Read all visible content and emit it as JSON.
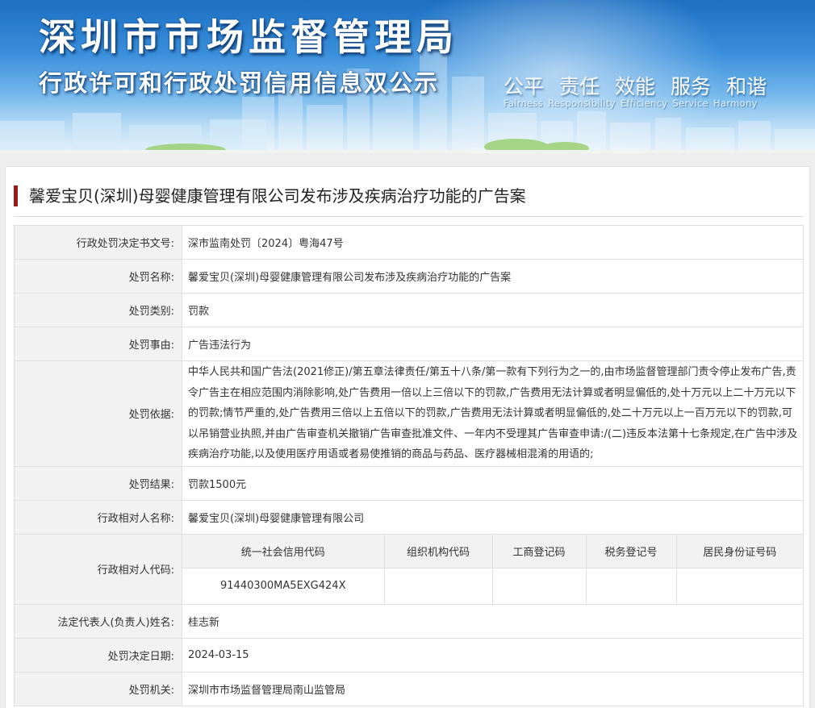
{
  "banner": {
    "title": "深圳市市场监督管理局",
    "subtitle": "行政许可和行政处罚信用信息双公示",
    "slogans": [
      {
        "cn": "公平",
        "en": "Fairness"
      },
      {
        "cn": "责任",
        "en": "Responsibility"
      },
      {
        "cn": "效能",
        "en": "Efficiency"
      },
      {
        "cn": "服务",
        "en": "Service"
      },
      {
        "cn": "和谐",
        "en": "Harmony"
      }
    ]
  },
  "case": {
    "title": "馨爱宝贝(深圳)母婴健康管理有限公司发布涉及疾病治疗功能的广告案"
  },
  "fields": {
    "decision_no": {
      "label": "行政处罚决定书文号:",
      "value": "深市监南处罚〔2024〕粤海47号"
    },
    "penalty_name": {
      "label": "处罚名称:",
      "value": "馨爱宝贝(深圳)母婴健康管理有限公司发布涉及疾病治疗功能的广告案"
    },
    "penalty_type": {
      "label": "处罚类别:",
      "value": "罚款"
    },
    "penalty_reason": {
      "label": "处罚事由:",
      "value": "广告违法行为"
    },
    "penalty_basis": {
      "label": "处罚依据:",
      "value": "中华人民共和国广告法(2021修正)/第五章法律责任/第五十八条/第一款有下列行为之一的,由市场监督管理部门责令停止发布广告,责令广告主在相应范围内消除影响,处广告费用一倍以上三倍以下的罚款,广告费用无法计算或者明显偏低的,处十万元以上二十万元以下的罚款;情节严重的,处广告费用三倍以上五倍以下的罚款,广告费用无法计算或者明显偏低的,处二十万元以上一百万元以下的罚款,可以吊销营业执照,并由广告审查机关撤销广告审查批准文件、一年内不受理其广告审查申请:/(二)违反本法第十七条规定,在广告中涉及疾病治疗功能,以及使用医疗用语或者易使推销的商品与药品、医疗器械相混淆的用语的;"
    },
    "penalty_result": {
      "label": "处罚结果:",
      "value": "罚款1500元"
    },
    "party_name": {
      "label": "行政相对人名称:",
      "value": "馨爱宝贝(深圳)母婴健康管理有限公司"
    },
    "party_code": {
      "label": "行政相对人代码:",
      "headers": [
        "统一社会信用代码",
        "组织机构代码",
        "工商登记码",
        "税务登记号",
        "居民身份证号码"
      ],
      "values": [
        "91440300MA5EXG424X",
        "",
        "",
        "",
        ""
      ]
    },
    "legal_rep": {
      "label": "法定代表人(负责人)姓名:",
      "value": "桂志新"
    },
    "decision_date": {
      "label": "处罚决定日期:",
      "value": "2024-03-15"
    },
    "authority": {
      "label": "处罚机关:",
      "value": "深圳市市场监督管理局南山监管局"
    }
  }
}
